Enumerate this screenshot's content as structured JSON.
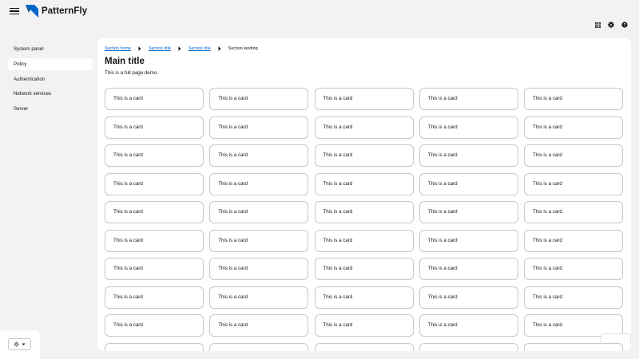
{
  "masthead": {
    "brand": "PatternFly",
    "icons": [
      "hamburger-icon",
      "grid-icon",
      "gear-icon",
      "help-icon"
    ]
  },
  "sidebar": {
    "items": [
      {
        "label": "System panel",
        "current": false
      },
      {
        "label": "Policy",
        "current": true
      },
      {
        "label": "Authentication",
        "current": false
      },
      {
        "label": "Network services",
        "current": false
      },
      {
        "label": "Server",
        "current": false
      }
    ],
    "theme_toggle_icon": "sun-icon"
  },
  "breadcrumb": {
    "items": [
      "Section home",
      "Section title",
      "Section title"
    ],
    "current": "Section landing"
  },
  "page": {
    "title": "Main title",
    "description": "This is a full page demo."
  },
  "cards": [
    "This is a card",
    "This is a card",
    "This is a card",
    "This is a card",
    "This is a card",
    "This is a card",
    "This is a card",
    "This is a card",
    "This is a card",
    "This is a card",
    "This is a card",
    "This is a card",
    "This is a card",
    "This is a card",
    "This is a card",
    "This is a card",
    "This is a card",
    "This is a card",
    "This is a card",
    "This is a card",
    "This is a card",
    "This is a card",
    "This is a card",
    "This is a card",
    "This is a card",
    "This is a card",
    "This is a card",
    "This is a card",
    "This is a card",
    "This is a card",
    "This is a card",
    "This is a card",
    "This is a card",
    "This is a card",
    "This is a card",
    "This is a card",
    "This is a card",
    "This is a card",
    "This is a card",
    "This is a card",
    "This is a card",
    "This is a card",
    "This is a card",
    "This is a card",
    "This is a card",
    "",
    "",
    "",
    "",
    ""
  ],
  "colors": {
    "link": "#0066cc",
    "logo_blue": "#0066cc",
    "background": "#f2f2f2",
    "surface": "#ffffff",
    "card_border": "#c7c7c7"
  }
}
